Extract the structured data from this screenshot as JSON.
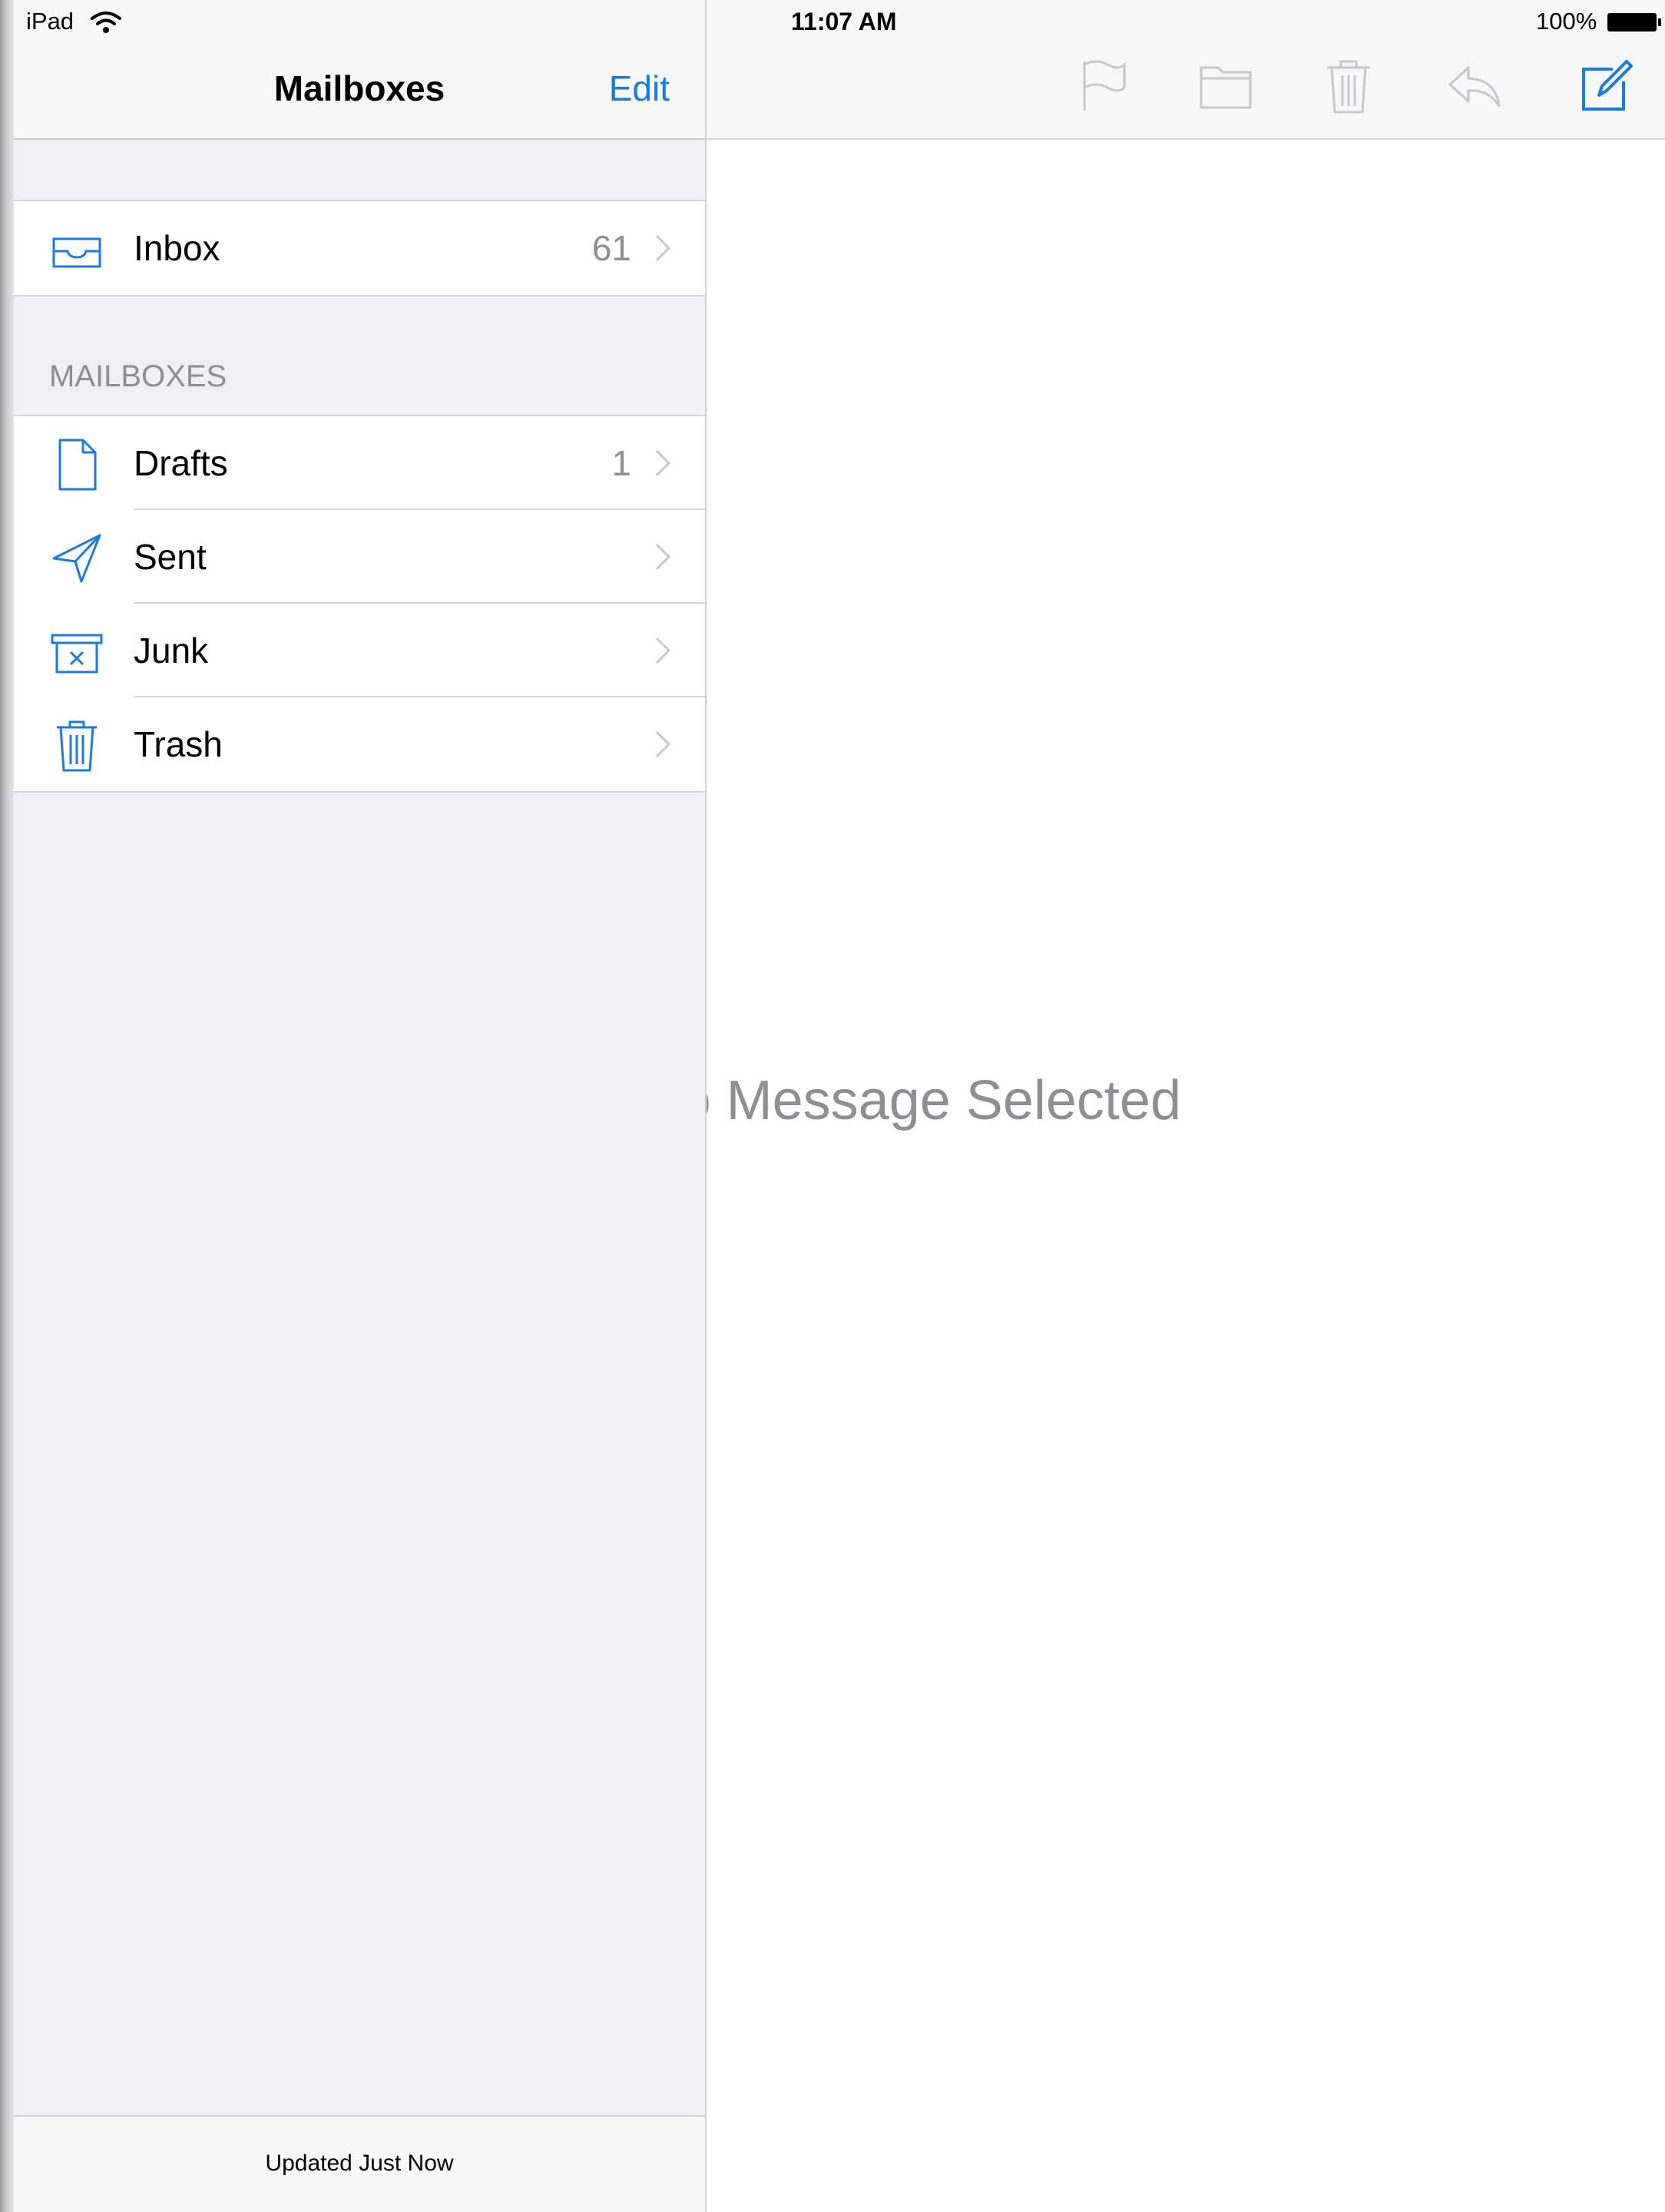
{
  "status_bar": {
    "device": "iPad",
    "time": "11:07 AM",
    "battery": "100%"
  },
  "sidebar": {
    "title": "Mailboxes",
    "edit_label": "Edit",
    "inbox": {
      "label": "Inbox",
      "count": "61",
      "icon": "inbox-icon"
    },
    "section_header": "MAILBOXES",
    "mailboxes": [
      {
        "label": "Drafts",
        "count": "1",
        "icon": "drafts-icon"
      },
      {
        "label": "Sent",
        "count": "",
        "icon": "sent-icon"
      },
      {
        "label": "Junk",
        "count": "",
        "icon": "junk-icon"
      },
      {
        "label": "Trash",
        "count": "",
        "icon": "trash-icon"
      }
    ],
    "footer": "Updated Just Now"
  },
  "detail": {
    "empty_message": "No Message Selected",
    "toolbar": [
      "flag-icon",
      "folder-icon",
      "trash-icon",
      "reply-icon",
      "compose-icon"
    ]
  },
  "colors": {
    "accent": "#1b7ae0",
    "disabled_icon": "#c7c7cc",
    "sidebar_bg": "#efeff4",
    "secondary_text": "#8e8e93"
  }
}
